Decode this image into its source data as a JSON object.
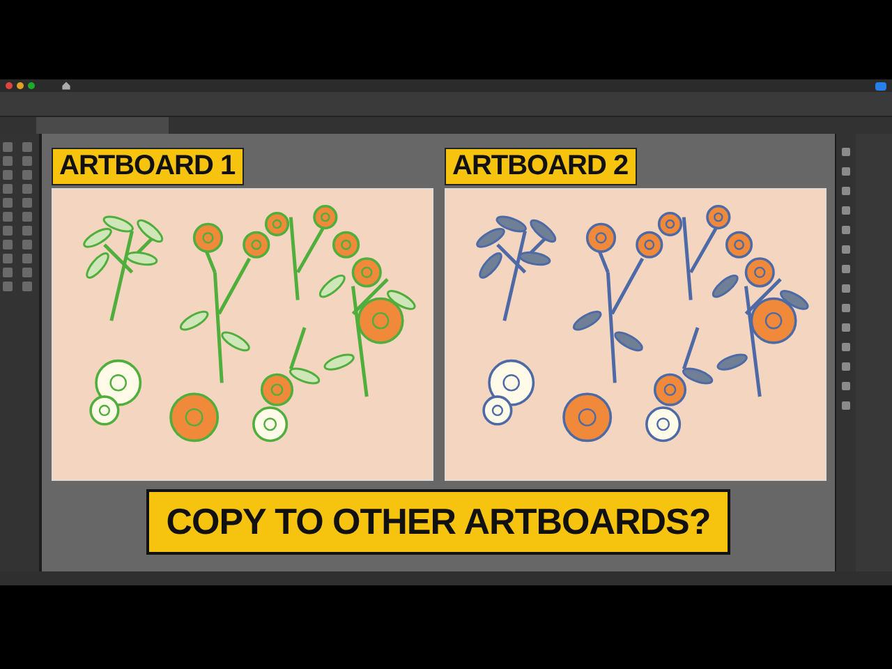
{
  "artboards": [
    {
      "label": "ARTBOARD 1",
      "color": "#4fae3c"
    },
    {
      "label": "ARTBOARD 2",
      "color": "#4e6aa6"
    }
  ],
  "banner": {
    "text": "COPY TO OTHER ARTBOARDS?"
  }
}
